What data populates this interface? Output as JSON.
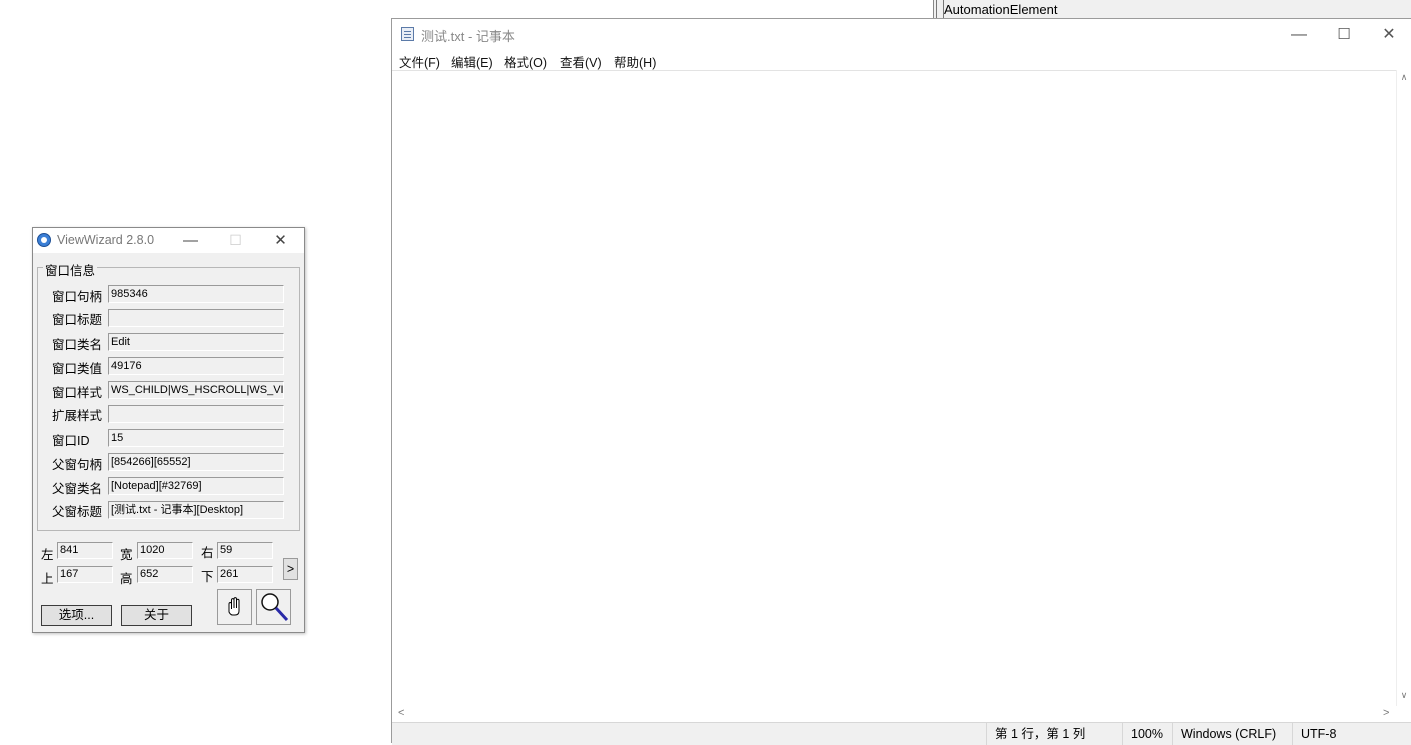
{
  "background": {
    "automation_label": "AutomationElement"
  },
  "notepad": {
    "title": "测试.txt - 记事本",
    "caption": {
      "minimize": "—",
      "maximize": "☐",
      "close": "✕"
    },
    "menu": [
      "文件(F)",
      "编辑(E)",
      "格式(O)",
      "查看(V)",
      "帮助(H)"
    ],
    "scroll": {
      "up": "∧",
      "down": "∨",
      "left": "<",
      "right": ">"
    },
    "status": {
      "position": "第 1 行，第 1 列",
      "zoom": "100%",
      "line_ending": "Windows (CRLF)",
      "encoding": "UTF-8"
    }
  },
  "viewwizard": {
    "title": "ViewWizard 2.8.0",
    "caption": {
      "minimize": "—",
      "maximize": "☐",
      "close": "✕"
    },
    "group_title": "窗口信息",
    "fields": [
      {
        "label": "窗口句柄",
        "value": "985346"
      },
      {
        "label": "窗口标题",
        "value": ""
      },
      {
        "label": "窗口类名",
        "value": "Edit"
      },
      {
        "label": "窗口类值",
        "value": "49176"
      },
      {
        "label": "窗口样式",
        "value": "WS_CHILD|WS_HSCROLL|WS_VISIBLE"
      },
      {
        "label": "扩展样式",
        "value": ""
      },
      {
        "label": "窗口ID",
        "value": "15"
      },
      {
        "label": "父窗句柄",
        "value": "[854266][65552]"
      },
      {
        "label": "父窗类名",
        "value": "[Notepad][#32769]"
      },
      {
        "label": "父窗标题",
        "value": "[测试.txt - 记事本][Desktop]"
      }
    ],
    "coords": {
      "left_label": "左",
      "left": "841",
      "width_label": "宽",
      "width": "1020",
      "right_label": "右",
      "right": "59",
      "top_label": "上",
      "top": "167",
      "height_label": "高",
      "height": "652",
      "bottom_label": "下",
      "bottom": "261"
    },
    "expand_button": ">",
    "options_button": "选项...",
    "about_button": "关于"
  }
}
